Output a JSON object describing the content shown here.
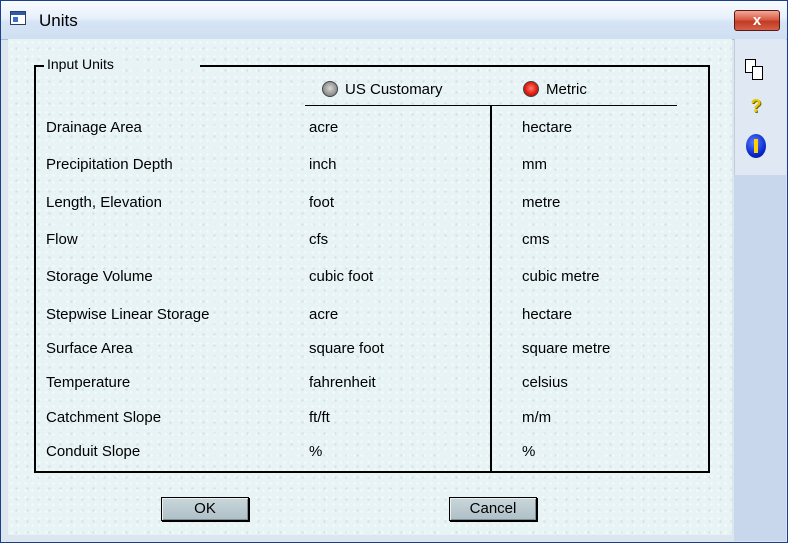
{
  "window": {
    "title": "Units",
    "close_glyph": "x"
  },
  "groupbox": {
    "legend": "Input Units"
  },
  "columns": {
    "us": {
      "label": "US Customary",
      "selected": false
    },
    "metric": {
      "label": "Metric",
      "selected": true
    }
  },
  "rows": [
    {
      "label": "Drainage Area",
      "us": "acre",
      "metric": "hectare"
    },
    {
      "label": "Precipitation Depth",
      "us": "inch",
      "metric": "mm"
    },
    {
      "label": "Length, Elevation",
      "us": "foot",
      "metric": "metre"
    },
    {
      "label": "Flow",
      "us": "cfs",
      "metric": "cms"
    },
    {
      "label": "Storage Volume",
      "us": "cubic foot",
      "metric": "cubic metre"
    },
    {
      "label": "Stepwise Linear Storage",
      "us": "acre",
      "metric": "hectare"
    },
    {
      "label": "Surface Area",
      "us": "square foot",
      "metric": "square metre"
    },
    {
      "label": "Temperature",
      "us": "fahrenheit",
      "metric": "celsius"
    },
    {
      "label": "Catchment Slope",
      "us": "ft/ft",
      "metric": "m/m"
    },
    {
      "label": "Conduit Slope",
      "us": "%",
      "metric": "%"
    }
  ],
  "buttons": {
    "ok": "OK",
    "cancel": "Cancel"
  },
  "toolbar": {
    "help_glyph": "?",
    "icons": [
      "copy-icon",
      "help-icon",
      "info-icon"
    ]
  }
}
